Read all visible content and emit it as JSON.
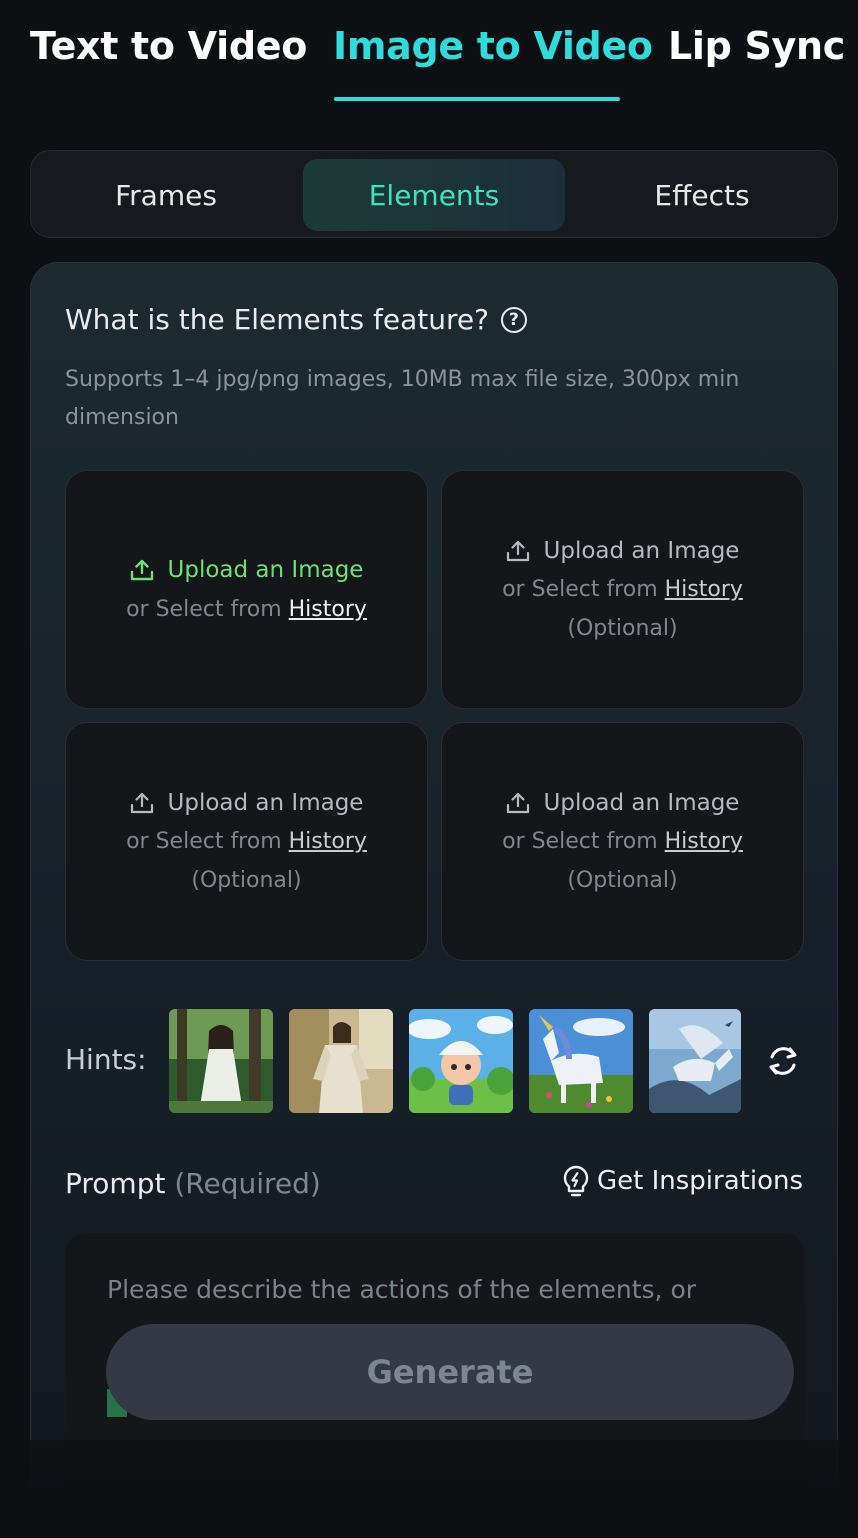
{
  "top_tabs": [
    {
      "label": "Text to Video",
      "active": false
    },
    {
      "label": "Image to Video",
      "active": true
    },
    {
      "label": "Lip Sync",
      "active": false
    }
  ],
  "segment": [
    {
      "label": "Frames",
      "active": false
    },
    {
      "label": "Elements",
      "active": true
    },
    {
      "label": "Effects",
      "active": false
    }
  ],
  "feature": {
    "title": "What is the Elements feature?",
    "help_icon": "question-circle-icon",
    "description": "Supports 1–4 jpg/png images, 10MB max file size, 300px min dimension"
  },
  "uploads": [
    {
      "label": "Upload an Image",
      "select_prefix": "or Select from ",
      "history": "History",
      "optional": ""
    },
    {
      "label": "Upload an Image",
      "select_prefix": "or Select from ",
      "history": "History",
      "optional": "(Optional)"
    },
    {
      "label": "Upload an Image",
      "select_prefix": "or Select from ",
      "history": "History",
      "optional": "(Optional)"
    },
    {
      "label": "Upload an Image",
      "select_prefix": "or Select from ",
      "history": "History",
      "optional": "(Optional)"
    }
  ],
  "hints": {
    "label": "Hints:",
    "refresh_icon": "refresh-icon"
  },
  "prompt": {
    "label": "Prompt",
    "required": "(Required)",
    "inspire_label": "Get Inspirations",
    "placeholder": "Please describe the actions of the elements, or"
  },
  "generate": {
    "label": "Generate"
  },
  "colors": {
    "accent": "#2fdcd9",
    "upload_green": "#6de07a",
    "segment_active": "#3de4b8"
  }
}
